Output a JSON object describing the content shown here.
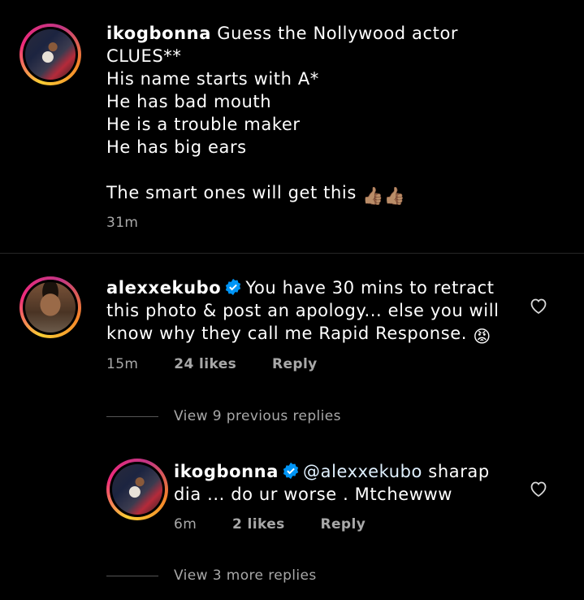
{
  "post": {
    "username": "ikogbonna",
    "caption_line1": "Guess the Nollywood actor",
    "caption_lines": [
      "CLUES**",
      "His name starts with A*",
      "He has bad mouth",
      "He is a trouble maker",
      "He has big ears"
    ],
    "caption_end": "The smart ones will get this",
    "caption_emoji": "👍🏽👍🏽",
    "time": "31m"
  },
  "comment1": {
    "username": "alexxekubo",
    "text_line1": "You have 30 mins to retract",
    "text_line2": "this photo & post an apology... else you will",
    "text_line3": "know why they call me Rapid Response.",
    "emoji": "😡",
    "time": "15m",
    "likes": "24 likes",
    "reply_label": "Reply",
    "view_replies": "View 9 previous replies"
  },
  "reply1": {
    "username": "ikogbonna",
    "mention": "@alexxekubo",
    "text_line1": "sharap",
    "text_line2": "dia ... do ur worse . Mtchewww",
    "time": "6m",
    "likes": "2 likes",
    "reply_label": "Reply",
    "view_more": "View 3 more replies"
  },
  "colors": {
    "background": "#000000",
    "secondary_text": "#a8a8a8",
    "verified": "#0095f6"
  }
}
